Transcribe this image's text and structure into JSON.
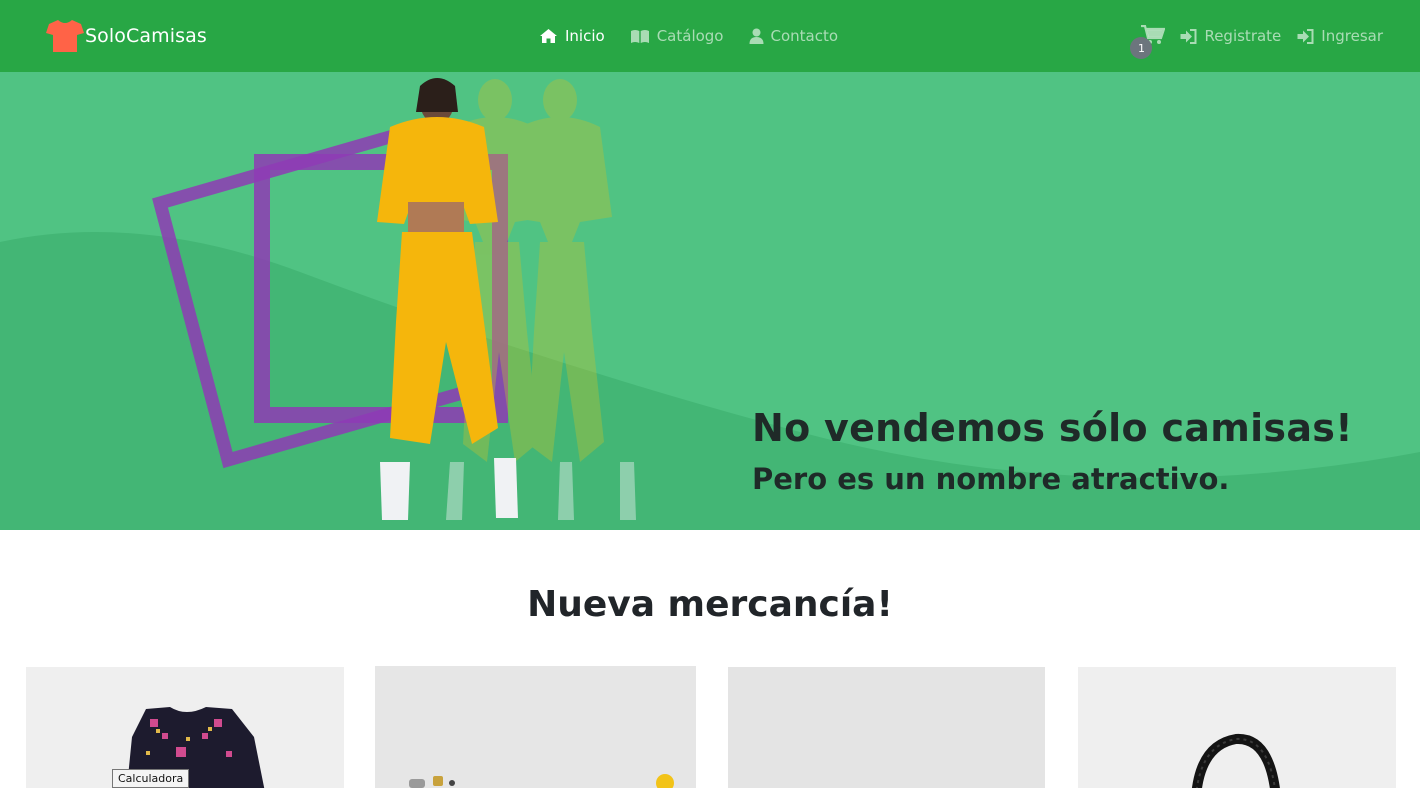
{
  "navbar": {
    "brand": "SoloCamisas",
    "brand_icon": "tshirt-icon",
    "brand_icon_color": "#ff6347",
    "background_color": "#28a745",
    "links": [
      {
        "label": "Inicio",
        "icon": "home-icon",
        "active": true
      },
      {
        "label": "Catálogo",
        "icon": "book-icon",
        "active": false
      },
      {
        "label": "Contacto",
        "icon": "user-icon",
        "active": false
      }
    ],
    "cart": {
      "icon": "cart-icon",
      "count": "1"
    },
    "auth": [
      {
        "label": "Registrate",
        "icon": "sign-in-icon"
      },
      {
        "label": "Ingresar",
        "icon": "sign-in-icon"
      }
    ]
  },
  "hero": {
    "title": "No vendemos sólo camisas!",
    "subtitle": "Pero es un nombre atractivo.",
    "background_color": "#50c383",
    "frame_color": "#8e3bb5",
    "outfit_color": "#f5b60c"
  },
  "products": {
    "heading": "Nueva mercancía!",
    "cards": [
      {
        "image": "embroidered-blouse-image"
      },
      {
        "image": "accessories-image"
      },
      {
        "image": "plain-product-image"
      },
      {
        "image": "black-bag-image"
      }
    ]
  },
  "tooltip": "Calculadora"
}
